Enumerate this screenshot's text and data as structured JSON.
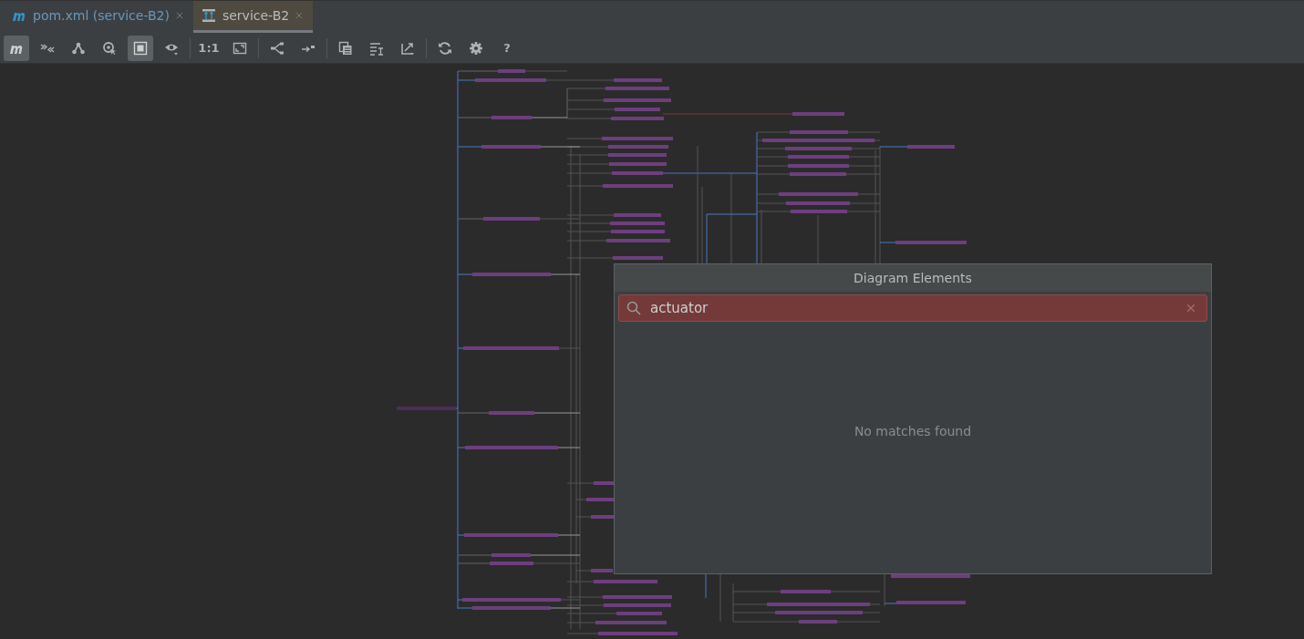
{
  "tabs": [
    {
      "kind": "maven",
      "label": "pom.xml (service-B2)",
      "selected": false
    },
    {
      "kind": "diagram",
      "label": "service-B2",
      "selected": true
    }
  ],
  "toolbar": [
    {
      "kind": "icon",
      "selected": true
    },
    {
      "kind": "icon",
      "selected": false
    },
    {
      "kind": "icon",
      "selected": false
    },
    {
      "kind": "icon",
      "selected": false
    },
    {
      "kind": "icon",
      "selected": true
    },
    {
      "kind": "icon",
      "selected": false
    },
    {
      "kind": "separator"
    },
    {
      "kind": "text",
      "label": "1:1"
    },
    {
      "kind": "icon",
      "selected": false
    },
    {
      "kind": "separator"
    },
    {
      "kind": "icon",
      "selected": false
    },
    {
      "kind": "icon",
      "selected": false
    },
    {
      "kind": "separator"
    },
    {
      "kind": "icon",
      "selected": false
    },
    {
      "kind": "icon",
      "selected": false
    },
    {
      "kind": "icon",
      "selected": false
    },
    {
      "kind": "separator"
    },
    {
      "kind": "icon",
      "selected": false
    },
    {
      "kind": "icon",
      "selected": false
    },
    {
      "kind": "text",
      "label": "?"
    }
  ],
  "popup": {
    "title": "Diagram Elements",
    "search": {
      "value": "actuator",
      "no_match": true
    },
    "message": "No matches found"
  }
}
